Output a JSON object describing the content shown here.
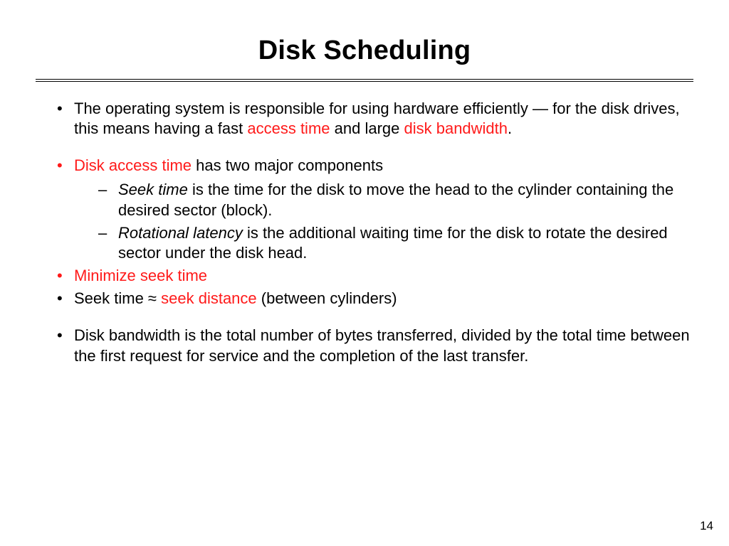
{
  "title": "Disk Scheduling",
  "page_number": "14",
  "bullets": {
    "b1": {
      "t1": "The operating system is responsible for using hardware efficiently — for the disk drives, this means having a fast ",
      "r1": "access time",
      "t2": " and large ",
      "r2": "disk bandwidth",
      "t3": "."
    },
    "b2": {
      "r1": "Disk access time",
      "t1": " has two major components",
      "s1": {
        "e1": "Seek time",
        "t1": " is the time for the disk to move the head to the cylinder containing the desired sector (block)."
      },
      "s2": {
        "e1": "Rotational latency",
        "t1": " is the additional waiting time for the disk to rotate the desired sector under the disk head."
      }
    },
    "b3": {
      "r1": "Minimize seek time"
    },
    "b4": {
      "t1": "Seek time ≈ ",
      "r1": "seek distance",
      "t2": " (between cylinders)"
    },
    "b5": {
      "t1": "Disk bandwidth is the total number of bytes transferred, divided by the total time between the first request for service and the completion of the last transfer."
    }
  }
}
